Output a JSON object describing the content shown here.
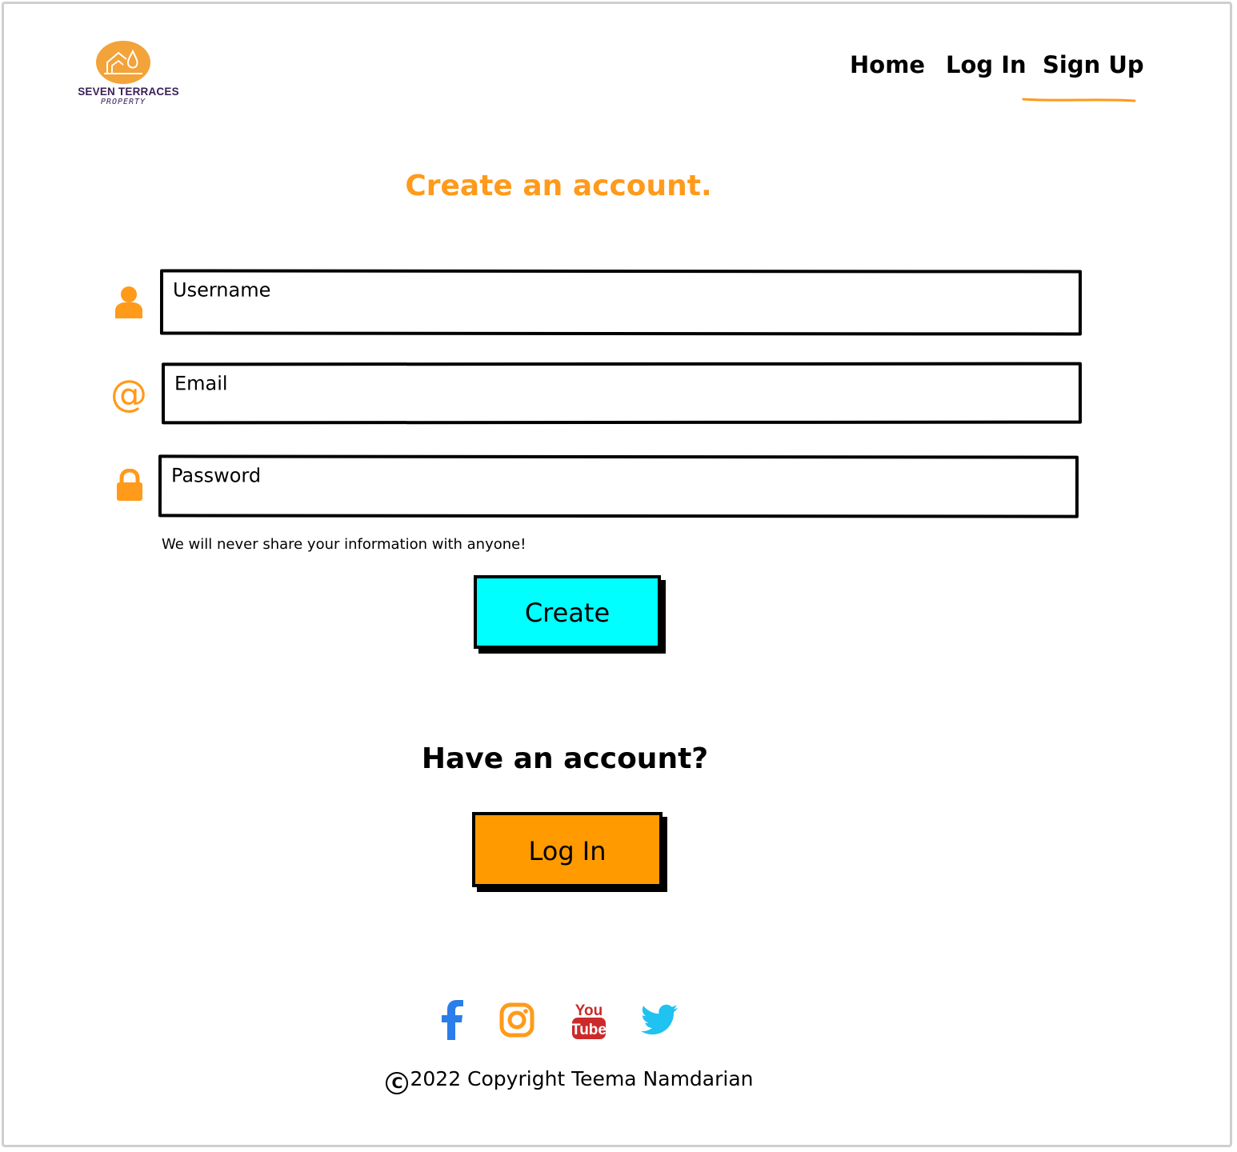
{
  "brand": {
    "name": "SEVEN TERRACES",
    "tagline": "PROPERTY",
    "color": "#3a2157",
    "logo_color": "#f2a33a"
  },
  "nav": {
    "items": [
      {
        "label": "Home"
      },
      {
        "label": "Log In"
      },
      {
        "label": "Sign Up",
        "active": true
      }
    ],
    "active_underline_color": "#ff9a1a"
  },
  "signup": {
    "title": "Create an account.",
    "title_color": "#ff9a1a",
    "fields": {
      "username": {
        "placeholder": "Username",
        "icon": "user-icon"
      },
      "email": {
        "placeholder": "Email",
        "icon": "at-sign-icon"
      },
      "password": {
        "placeholder": "Password",
        "icon": "lock-icon"
      }
    },
    "hint": "We will never share your information with anyone!",
    "submit_label": "Create",
    "submit_color": "#00ffff"
  },
  "login_prompt": {
    "heading": "Have an account?",
    "button_label": "Log In",
    "button_color": "#ff9a00"
  },
  "footer": {
    "social": [
      {
        "icon": "facebook-icon",
        "color": "#2b7de9"
      },
      {
        "icon": "instagram-icon",
        "color": "#ff9a1a"
      },
      {
        "icon": "youtube-icon",
        "color": "#cc2a2a"
      },
      {
        "icon": "twitter-icon",
        "color": "#1fc2f0"
      }
    ],
    "youtube_text_top": "You",
    "youtube_text_bottom": "Tube",
    "copyright_symbol": "C",
    "copyright": "2022 Copyright Teema Namdarian"
  },
  "accent_icon_color": "#ff9a1a"
}
